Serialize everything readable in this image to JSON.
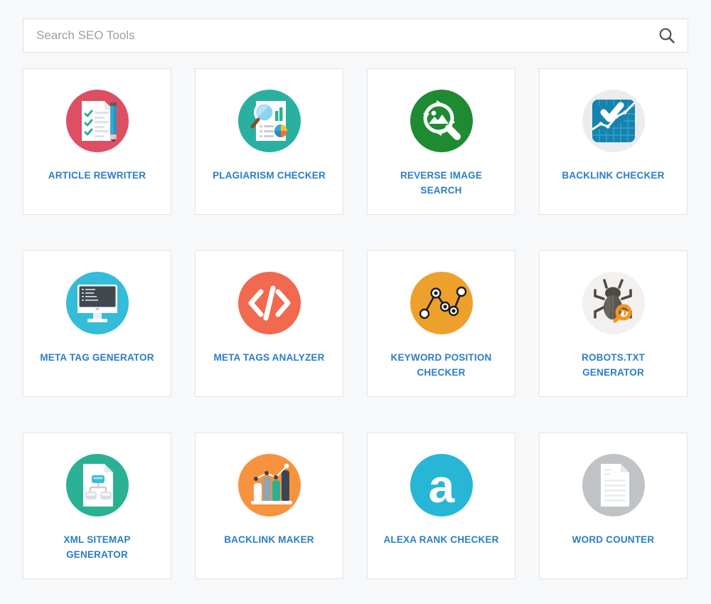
{
  "search": {
    "placeholder": "Search SEO Tools",
    "value": "",
    "icon": "search-icon",
    "button_label": ""
  },
  "colors": {
    "page_background": "#f7f8f9",
    "card_background": "#ffffff",
    "card_border": "#e2e4e6",
    "label_blue": "#2b7dc5",
    "article_rewriter_circle": "#dd4f63",
    "plagiarism_checker_circle": "#2ab0a0",
    "reverse_image_search_circle": "#1e8b32",
    "backlink_checker_circle": "#ebeced",
    "backlink_checker_tile": "#1583b0",
    "meta_tag_generator_circle": "#34bcd8",
    "meta_tags_analyzer_circle": "#f1694f",
    "keyword_position_checker_circle": "#eda02c",
    "robots_txt_generator_circle": "#f3f1ef",
    "xml_sitemap_generator_circle": "#2ab193",
    "backlink_maker_circle": "#f7933e",
    "alexa_rank_checker_circle": "#28b6d6",
    "word_counter_circle": "#c0c3c5"
  },
  "tools": [
    {
      "id": "article-rewriter",
      "label": "ARTICLE REWRITER",
      "icon": "document-checklist-pencil-icon"
    },
    {
      "id": "plagiarism-checker",
      "label": "PLAGIARISM CHECKER",
      "icon": "document-magnifier-charts-icon"
    },
    {
      "id": "reverse-image-search",
      "label": "REVERSE IMAGE SEARCH",
      "icon": "image-refresh-magnifier-icon"
    },
    {
      "id": "backlink-checker",
      "label": "BACKLINK CHECKER",
      "icon": "checkmark-growth-chart-icon"
    },
    {
      "id": "meta-tag-generator",
      "label": "META TAG GENERATOR",
      "icon": "monitor-code-icon"
    },
    {
      "id": "meta-tags-analyzer",
      "label": "META TAGS ANALYZER",
      "icon": "code-brackets-icon"
    },
    {
      "id": "keyword-position-checker",
      "label": "KEYWORD POSITION CHECKER",
      "icon": "line-chart-nodes-icon"
    },
    {
      "id": "robots-txt-generator",
      "label": "ROBOTS.TXT GENERATOR",
      "icon": "bug-magnifier-icon"
    },
    {
      "id": "xml-sitemap-generator",
      "label": "XML SITEMAP GENERATOR",
      "icon": "document-sitemap-icon"
    },
    {
      "id": "backlink-maker",
      "label": "BACKLINK MAKER",
      "icon": "bar-chart-trendline-icon"
    },
    {
      "id": "alexa-rank-checker",
      "label": "ALEXA RANK CHECKER",
      "icon": "alexa-letter-a-icon"
    },
    {
      "id": "word-counter",
      "label": "WORD COUNTER",
      "icon": "document-lines-icon"
    }
  ]
}
